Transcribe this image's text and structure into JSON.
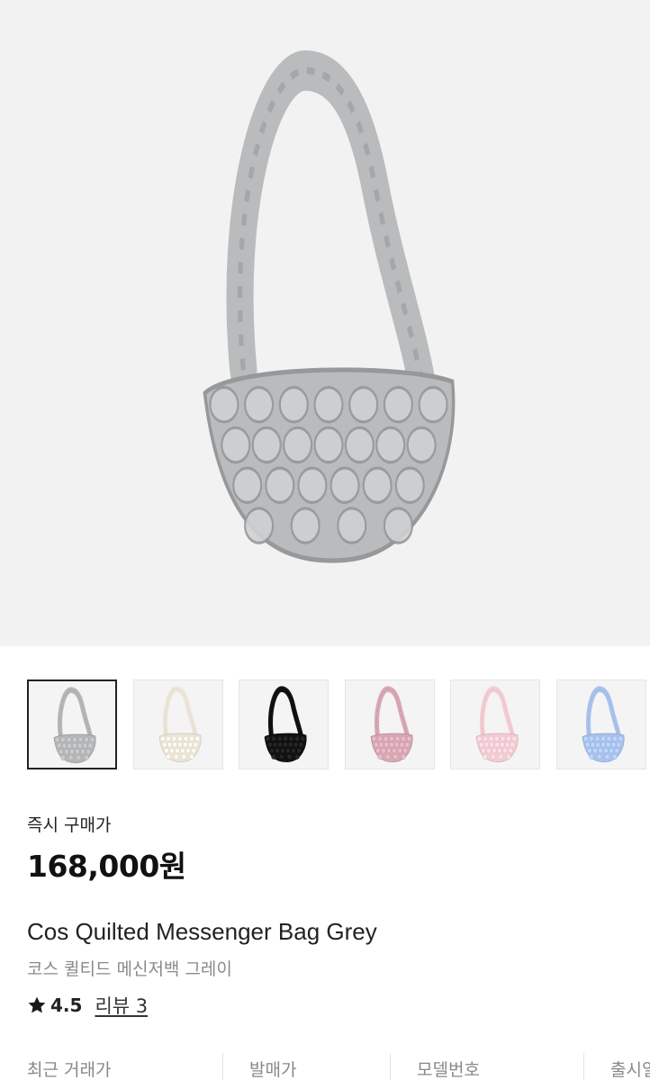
{
  "product": {
    "images": [
      {
        "color": "#b5b7b9",
        "selected": true,
        "icon": "grey-bag-thumbnail"
      },
      {
        "color": "#ece6da",
        "selected": false,
        "icon": "cream-bag-thumbnail"
      },
      {
        "color": "#121212",
        "selected": false,
        "icon": "black-bag-thumbnail"
      },
      {
        "color": "#d8a9b4",
        "selected": false,
        "icon": "pink-bag-thumbnail"
      },
      {
        "color": "#f3cdd4",
        "selected": false,
        "icon": "light-pink-bag-thumbnail"
      },
      {
        "color": "#a9c3ec",
        "selected": false,
        "icon": "blue-bag-thumbnail"
      }
    ],
    "hero_color": "#b9bbbd",
    "buy_now_label": "즉시 구매가",
    "price": "168,000원",
    "title_en": "Cos Quilted Messenger Bag Grey",
    "title_ko": "코스 퀼티드 메신저백 그레이",
    "rating": "4.5",
    "review_link": "리뷰 3",
    "star_icon": "star-icon"
  },
  "info_columns": [
    {
      "label": "최근 거래가"
    },
    {
      "label": "발매가"
    },
    {
      "label": "모델번호"
    },
    {
      "label": "출시일"
    }
  ]
}
